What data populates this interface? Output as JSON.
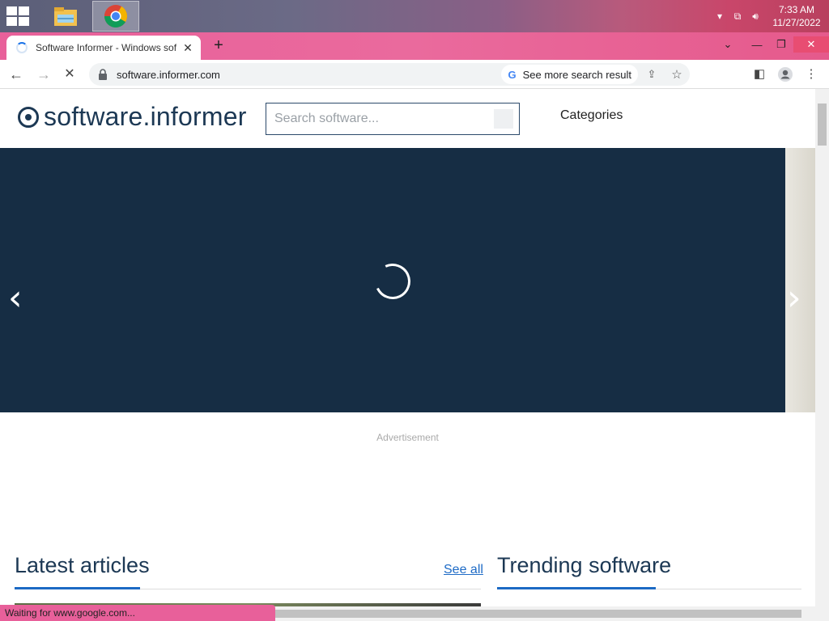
{
  "taskbar": {
    "apps": [
      {
        "name": "file-explorer"
      },
      {
        "name": "chrome",
        "active": true
      }
    ],
    "time": "7:33 AM",
    "date": "11/27/2022"
  },
  "browser": {
    "tab_title": "Software Informer - Windows sof",
    "url": "software.informer.com",
    "omnibox_suggestion": "See more search result",
    "status_text": "Waiting for www.google.com...",
    "accent_color": "#e8609a"
  },
  "site": {
    "logo_text": "software.informer",
    "search_placeholder": "Search software...",
    "categories_label": "Categories",
    "advertisement_label": "Advertisement",
    "latest_articles_title": "Latest articles",
    "see_all_label": "See all",
    "trending_title": "Trending software",
    "hero_color": "#162d44",
    "brand_color": "#1c3854",
    "link_color": "#1e6bc6"
  }
}
